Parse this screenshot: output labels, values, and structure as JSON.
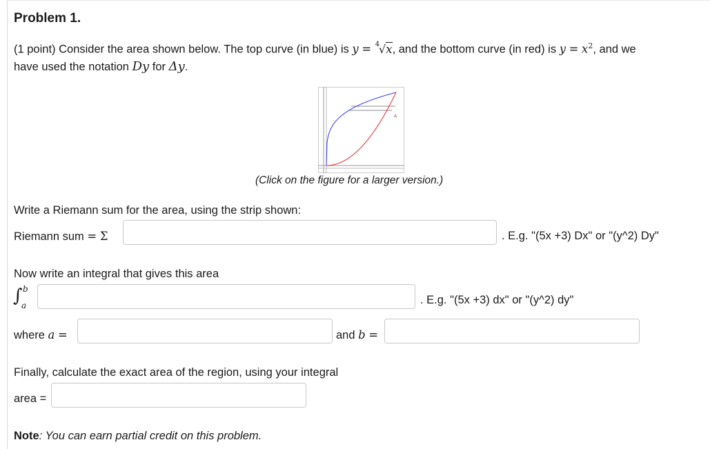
{
  "problem": {
    "title": "Problem 1.",
    "intro_prefix": "(1 point) Consider the area shown below. The top curve (in blue) is",
    "top_curve_lhs": "y",
    "eq": "=",
    "top_curve_root": "4",
    "top_curve_var": "x",
    "intro_middle": ", and the bottom curve (in red) is",
    "bottom_curve_lhs": "y",
    "bottom_curve_var": "x",
    "bottom_curve_exp": "2",
    "intro_suffix": ", and we",
    "line2_prefix": "have used the notation",
    "notation_dy": "Dy",
    "line2_for": "for",
    "notation_delta": "Δy",
    "line2_end": "."
  },
  "figure": {
    "caption": "(Click on the figure for a larger version.)",
    "strip_label": "Δ"
  },
  "riemann": {
    "prompt": "Write a Riemann sum for the area, using the strip shown:",
    "label": "Riemann sum",
    "eq": "=",
    "sigma": "Σ",
    "value": "",
    "hint": ". E.g. \"(5x +3) Dx\" or \"(y^2) Dy\""
  },
  "integral": {
    "prompt": "Now write an integral that gives this area",
    "symbol": "∫",
    "upper": "b",
    "lower": "a",
    "value": "",
    "hint": ". E.g. \"(5x +3) dx\" or \"(y^2) dy\""
  },
  "limits": {
    "where": "where",
    "a_var": "a",
    "eq": "=",
    "a_value": "",
    "and": "and",
    "b_var": "b",
    "b_value": ""
  },
  "area": {
    "prompt": "Finally, calculate the exact area of the region, using your integral",
    "label": "area =",
    "value": ""
  },
  "note": {
    "label": "Note",
    "text": ": You can earn partial credit on this problem."
  },
  "colors": {
    "top_curve": "#3333ff",
    "bottom_curve": "#e8222a",
    "input_border": "#c8c8c8"
  }
}
